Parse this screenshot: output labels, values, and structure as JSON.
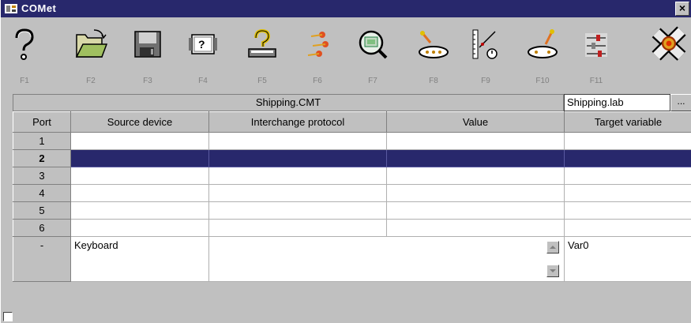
{
  "window": {
    "title": "COMet",
    "close_label": "×"
  },
  "toolbar": {
    "tools": [
      {
        "key": "F1",
        "icon": "help-icon"
      },
      {
        "key": "F2",
        "icon": "open-folder-icon"
      },
      {
        "key": "F3",
        "icon": "save-icon"
      },
      {
        "key": "F4",
        "icon": "device-query-icon"
      },
      {
        "key": "F5",
        "icon": "protocol-help-icon"
      },
      {
        "key": "F6",
        "icon": "fireworks-icon"
      },
      {
        "key": "F7",
        "icon": "monitor-search-icon"
      },
      {
        "key": "F8",
        "icon": "rocket-conveyor-icon"
      },
      {
        "key": "F9",
        "icon": "timer-gauge-icon"
      },
      {
        "key": "F10",
        "icon": "conveyor-icon"
      },
      {
        "key": "F11",
        "icon": "sliders-icon"
      },
      {
        "key": "",
        "icon": "comet-logo-icon"
      }
    ]
  },
  "file": {
    "name": "Shipping.CMT",
    "lab": "Shipping.lab",
    "browse_label": "..."
  },
  "table": {
    "columns": [
      "Port",
      "Source device",
      "Interchange protocol",
      "Value",
      "Target variable"
    ],
    "rows": [
      {
        "port": "1"
      },
      {
        "port": "2",
        "selected": true
      },
      {
        "port": "3"
      },
      {
        "port": "4"
      },
      {
        "port": "5"
      },
      {
        "port": "6"
      }
    ],
    "edit_row": {
      "port": "-",
      "source": "Keyboard",
      "target": "Var0"
    }
  },
  "colors": {
    "titlebar": "#28286c",
    "selection": "#28286c",
    "face": "#c0c0c0"
  }
}
